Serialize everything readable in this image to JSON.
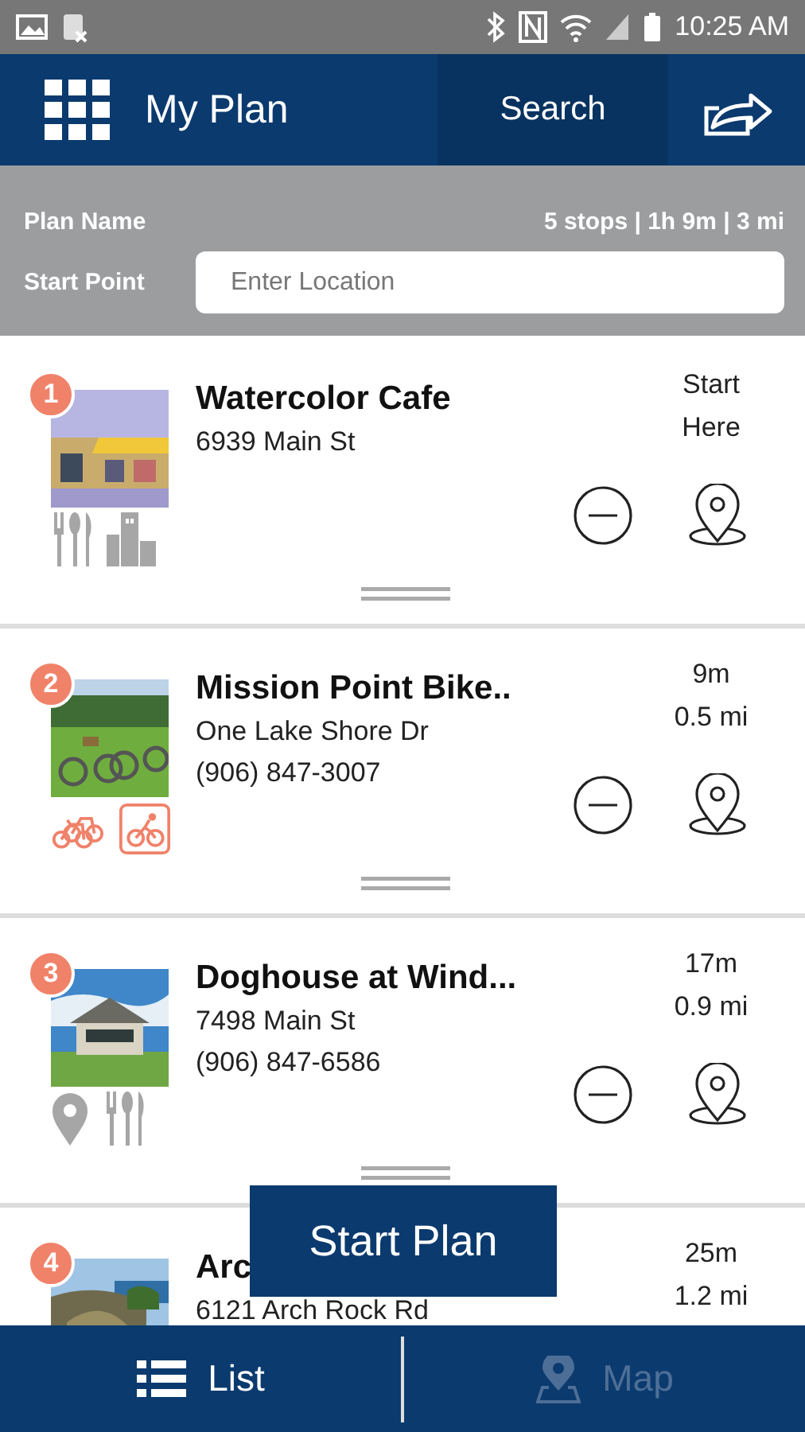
{
  "status_bar": {
    "time": "10:25 AM"
  },
  "header": {
    "title": "My Plan",
    "search_label": "Search"
  },
  "plan": {
    "name_label": "Plan Name",
    "summary": "5 stops | 1h 9m | 3 mi",
    "start_label": "Start Point",
    "start_field": {
      "placeholder": "Enter Location"
    }
  },
  "stops": [
    {
      "number": "1",
      "name": "Watercolor Cafe",
      "lines": [
        "6939 Main St"
      ],
      "leg": [
        "Start",
        "Here"
      ],
      "actions": true,
      "icons": [
        {
          "kind": "dining",
          "color": "#a6a6a6"
        },
        {
          "kind": "city",
          "color": "#a6a6a6"
        }
      ]
    },
    {
      "number": "2",
      "name": "Mission Point Bike..",
      "lines": [
        "One Lake Shore Dr",
        "(906) 847-3007"
      ],
      "leg": [
        "9m",
        "0.5 mi"
      ],
      "actions": true,
      "icons": [
        {
          "kind": "bikes",
          "color": "#f0826a"
        },
        {
          "kind": "cycling",
          "color": "#f0826a"
        }
      ]
    },
    {
      "number": "3",
      "name": "Doghouse at Wind...",
      "lines": [
        "7498 Main St",
        "(906) 847-6586"
      ],
      "leg": [
        "17m",
        "0.9 mi"
      ],
      "actions": true,
      "icons": [
        {
          "kind": "pin",
          "color": "#a6a6a6"
        },
        {
          "kind": "dining",
          "color": "#a6a6a6"
        }
      ]
    },
    {
      "number": "4",
      "name": "Arc",
      "lines": [
        "6121 Arch Rock Rd"
      ],
      "leg": [
        "25m",
        "1.2 mi"
      ],
      "actions": false
    }
  ],
  "start_button": {
    "label": "Start Plan"
  },
  "nav": {
    "tabs": [
      {
        "label": "List",
        "kind": "list",
        "selected": true
      },
      {
        "label": "Map",
        "kind": "map",
        "selected": false
      }
    ]
  }
}
